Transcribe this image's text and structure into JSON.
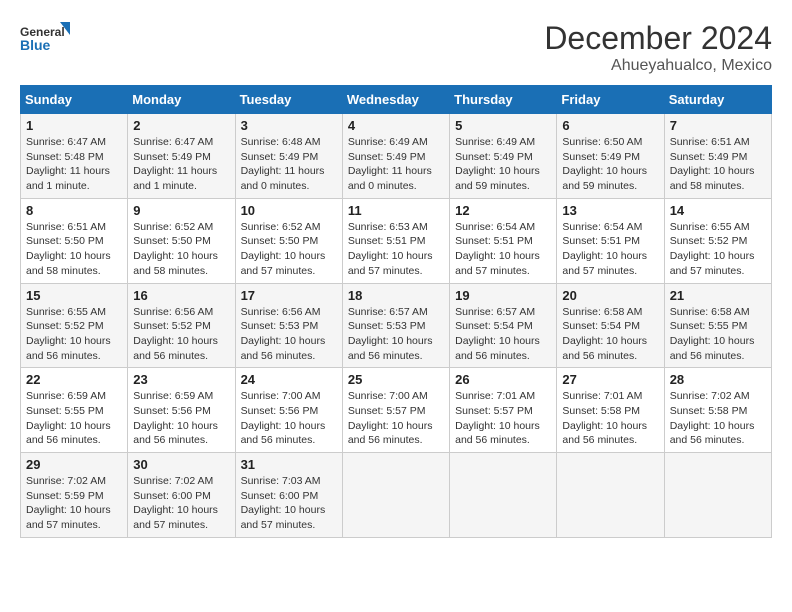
{
  "header": {
    "logo_line1": "General",
    "logo_line2": "Blue",
    "month": "December 2024",
    "location": "Ahueyahualco, Mexico"
  },
  "weekdays": [
    "Sunday",
    "Monday",
    "Tuesday",
    "Wednesday",
    "Thursday",
    "Friday",
    "Saturday"
  ],
  "weeks": [
    [
      {
        "day": "1",
        "info": "Sunrise: 6:47 AM\nSunset: 5:48 PM\nDaylight: 11 hours and 1 minute."
      },
      {
        "day": "2",
        "info": "Sunrise: 6:47 AM\nSunset: 5:49 PM\nDaylight: 11 hours and 1 minute."
      },
      {
        "day": "3",
        "info": "Sunrise: 6:48 AM\nSunset: 5:49 PM\nDaylight: 11 hours and 0 minutes."
      },
      {
        "day": "4",
        "info": "Sunrise: 6:49 AM\nSunset: 5:49 PM\nDaylight: 11 hours and 0 minutes."
      },
      {
        "day": "5",
        "info": "Sunrise: 6:49 AM\nSunset: 5:49 PM\nDaylight: 10 hours and 59 minutes."
      },
      {
        "day": "6",
        "info": "Sunrise: 6:50 AM\nSunset: 5:49 PM\nDaylight: 10 hours and 59 minutes."
      },
      {
        "day": "7",
        "info": "Sunrise: 6:51 AM\nSunset: 5:49 PM\nDaylight: 10 hours and 58 minutes."
      }
    ],
    [
      {
        "day": "8",
        "info": "Sunrise: 6:51 AM\nSunset: 5:50 PM\nDaylight: 10 hours and 58 minutes."
      },
      {
        "day": "9",
        "info": "Sunrise: 6:52 AM\nSunset: 5:50 PM\nDaylight: 10 hours and 58 minutes."
      },
      {
        "day": "10",
        "info": "Sunrise: 6:52 AM\nSunset: 5:50 PM\nDaylight: 10 hours and 57 minutes."
      },
      {
        "day": "11",
        "info": "Sunrise: 6:53 AM\nSunset: 5:51 PM\nDaylight: 10 hours and 57 minutes."
      },
      {
        "day": "12",
        "info": "Sunrise: 6:54 AM\nSunset: 5:51 PM\nDaylight: 10 hours and 57 minutes."
      },
      {
        "day": "13",
        "info": "Sunrise: 6:54 AM\nSunset: 5:51 PM\nDaylight: 10 hours and 57 minutes."
      },
      {
        "day": "14",
        "info": "Sunrise: 6:55 AM\nSunset: 5:52 PM\nDaylight: 10 hours and 57 minutes."
      }
    ],
    [
      {
        "day": "15",
        "info": "Sunrise: 6:55 AM\nSunset: 5:52 PM\nDaylight: 10 hours and 56 minutes."
      },
      {
        "day": "16",
        "info": "Sunrise: 6:56 AM\nSunset: 5:52 PM\nDaylight: 10 hours and 56 minutes."
      },
      {
        "day": "17",
        "info": "Sunrise: 6:56 AM\nSunset: 5:53 PM\nDaylight: 10 hours and 56 minutes."
      },
      {
        "day": "18",
        "info": "Sunrise: 6:57 AM\nSunset: 5:53 PM\nDaylight: 10 hours and 56 minutes."
      },
      {
        "day": "19",
        "info": "Sunrise: 6:57 AM\nSunset: 5:54 PM\nDaylight: 10 hours and 56 minutes."
      },
      {
        "day": "20",
        "info": "Sunrise: 6:58 AM\nSunset: 5:54 PM\nDaylight: 10 hours and 56 minutes."
      },
      {
        "day": "21",
        "info": "Sunrise: 6:58 AM\nSunset: 5:55 PM\nDaylight: 10 hours and 56 minutes."
      }
    ],
    [
      {
        "day": "22",
        "info": "Sunrise: 6:59 AM\nSunset: 5:55 PM\nDaylight: 10 hours and 56 minutes."
      },
      {
        "day": "23",
        "info": "Sunrise: 6:59 AM\nSunset: 5:56 PM\nDaylight: 10 hours and 56 minutes."
      },
      {
        "day": "24",
        "info": "Sunrise: 7:00 AM\nSunset: 5:56 PM\nDaylight: 10 hours and 56 minutes."
      },
      {
        "day": "25",
        "info": "Sunrise: 7:00 AM\nSunset: 5:57 PM\nDaylight: 10 hours and 56 minutes."
      },
      {
        "day": "26",
        "info": "Sunrise: 7:01 AM\nSunset: 5:57 PM\nDaylight: 10 hours and 56 minutes."
      },
      {
        "day": "27",
        "info": "Sunrise: 7:01 AM\nSunset: 5:58 PM\nDaylight: 10 hours and 56 minutes."
      },
      {
        "day": "28",
        "info": "Sunrise: 7:02 AM\nSunset: 5:58 PM\nDaylight: 10 hours and 56 minutes."
      }
    ],
    [
      {
        "day": "29",
        "info": "Sunrise: 7:02 AM\nSunset: 5:59 PM\nDaylight: 10 hours and 57 minutes."
      },
      {
        "day": "30",
        "info": "Sunrise: 7:02 AM\nSunset: 6:00 PM\nDaylight: 10 hours and 57 minutes."
      },
      {
        "day": "31",
        "info": "Sunrise: 7:03 AM\nSunset: 6:00 PM\nDaylight: 10 hours and 57 minutes."
      },
      null,
      null,
      null,
      null
    ]
  ]
}
